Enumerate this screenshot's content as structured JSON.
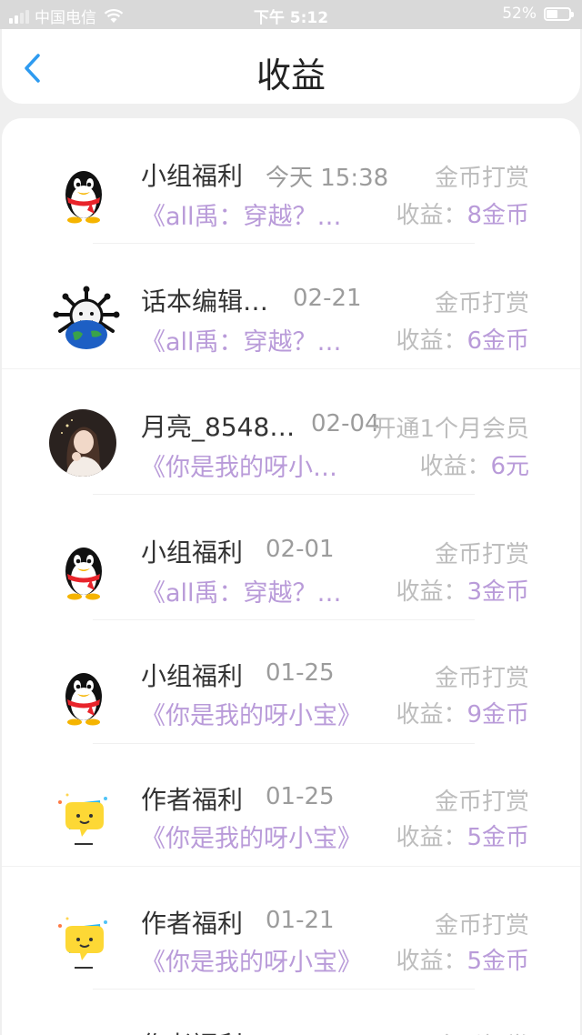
{
  "status_bar": {
    "carrier": "中国电信",
    "time": "下午 5:12",
    "battery": "52%",
    "battery_level": 0.52
  },
  "nav": {
    "title": "收益",
    "back_icon": "chevron-left-icon",
    "accent": "#2e9bf0"
  },
  "colors": {
    "purple": "#b99bd9",
    "gray": "#bdbdbd"
  },
  "rows": [
    {
      "avatar": "qq-penguin-icon",
      "name": "小组福利",
      "date": "今天 15:38",
      "type": "金币打赏",
      "book": "《all禹：穿越？…",
      "earn_label": "收益：",
      "earn_value": "8金币"
    },
    {
      "avatar": "virus-globe-avatar",
      "name": "话本编辑…",
      "date": "02-21",
      "type": "金币打赏",
      "book": "《all禹：穿越？…",
      "earn_label": "收益：",
      "earn_value": "6金币"
    },
    {
      "avatar": "girl-photo-avatar",
      "name": "月亮_8548…",
      "date": "02-04",
      "type": "开通1个月会员",
      "book": "《你是我的呀小…",
      "earn_label": "收益：",
      "earn_value": "6元"
    },
    {
      "avatar": "qq-penguin-icon",
      "name": "小组福利",
      "date": "02-01",
      "type": "金币打赏",
      "book": "《all禹：穿越？…",
      "earn_label": "收益：",
      "earn_value": "3金币"
    },
    {
      "avatar": "qq-penguin-icon",
      "name": "小组福利",
      "date": "01-25",
      "type": "金币打赏",
      "book": "《你是我的呀小宝》",
      "earn_label": "收益：",
      "earn_value": "9金币"
    },
    {
      "avatar": "chat-bubble-icon",
      "name": "作者福利",
      "date": "01-25",
      "type": "金币打赏",
      "book": "《你是我的呀小宝》",
      "earn_label": "收益：",
      "earn_value": "5金币"
    },
    {
      "avatar": "chat-bubble-icon",
      "name": "作者福利",
      "date": "01-21",
      "type": "金币打赏",
      "book": "《你是我的呀小宝》",
      "earn_label": "收益：",
      "earn_value": "5金币"
    },
    {
      "avatar": "chat-bubble-icon",
      "name": "作者福利",
      "date": "",
      "type": "金币打赏",
      "book": "",
      "earn_label": "",
      "earn_value": ""
    }
  ]
}
